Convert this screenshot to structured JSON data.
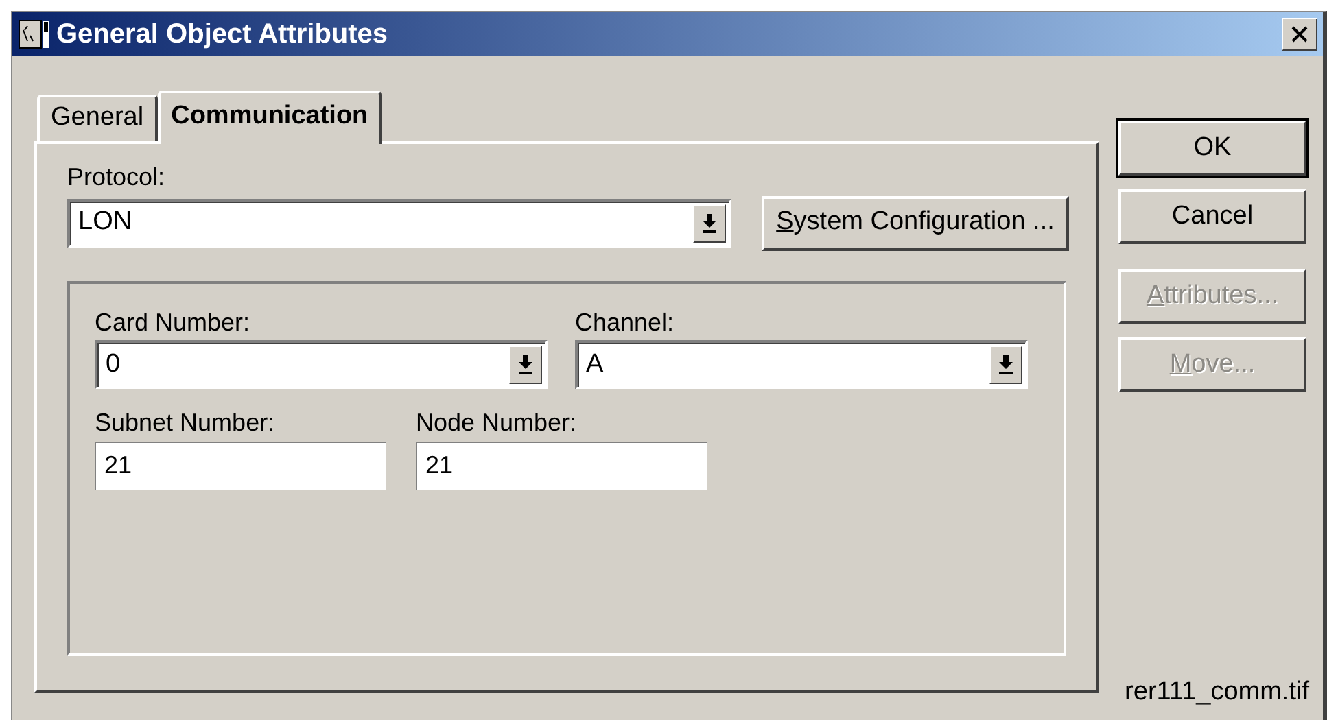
{
  "window": {
    "title": "General Object Attributes"
  },
  "tabs": [
    {
      "label": "General",
      "selected": false
    },
    {
      "label": "Communication",
      "selected": true
    }
  ],
  "protocol": {
    "label": "Protocol:",
    "value": "LON"
  },
  "system_configuration_button": {
    "label": "System Configuration ...",
    "mnemonic_first": true
  },
  "fields": [
    {
      "kind": "combo",
      "label": "Card Number:",
      "value": "0"
    },
    {
      "kind": "combo",
      "label": "Channel:",
      "value": "A"
    },
    {
      "kind": "text",
      "label": "Subnet Number:",
      "value": "21"
    },
    {
      "kind": "text",
      "label": "Node Number:",
      "value": "21"
    }
  ],
  "buttons": [
    {
      "label": "OK",
      "default": true,
      "disabled": false,
      "mnemonic_first": false
    },
    {
      "label": "Cancel",
      "default": false,
      "disabled": false,
      "mnemonic_first": false
    },
    {
      "label": "Attributes...",
      "default": false,
      "disabled": true,
      "mnemonic_first": true
    },
    {
      "label": "Move...",
      "default": false,
      "disabled": true,
      "mnemonic_first": true
    }
  ],
  "caption": "rer111_comm.tif"
}
